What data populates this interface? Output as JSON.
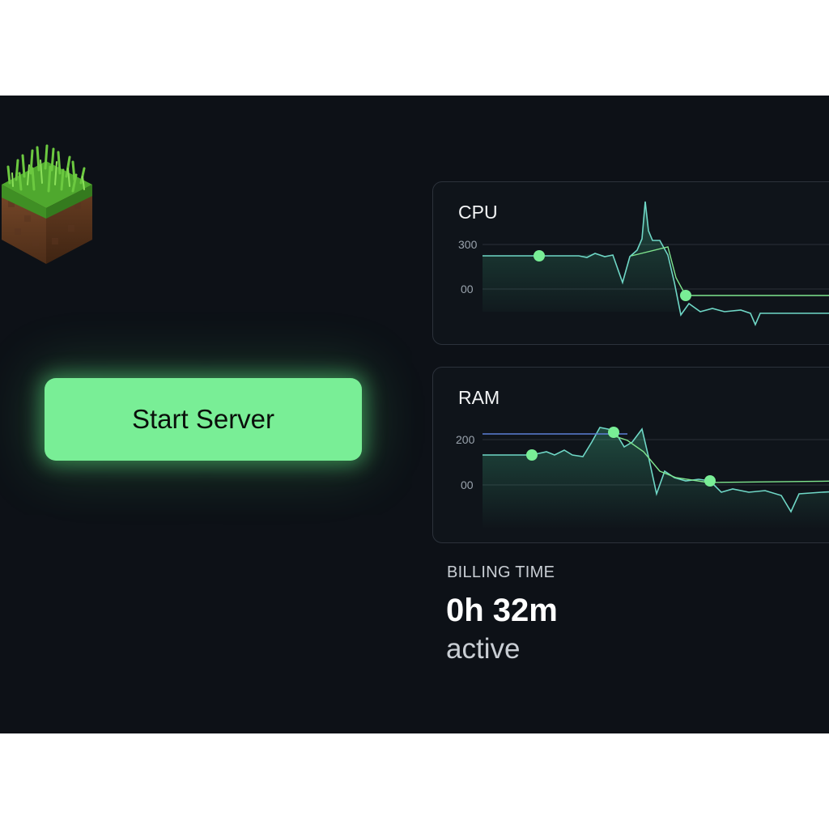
{
  "server": {
    "start_label": "Start Server"
  },
  "logo_icon": "grass-block-icon",
  "metrics": {
    "cpu": {
      "title": "CPU",
      "ticks": [
        "300",
        "00"
      ]
    },
    "ram": {
      "title": "RAM",
      "ticks": [
        "200",
        "00"
      ]
    }
  },
  "billing": {
    "label": "BILLING TIME",
    "value": "0h 32m",
    "status": "active"
  },
  "colors": {
    "accent": "#79ee96",
    "background": "#0d1117",
    "line": "#6fd7c6",
    "secondary_line": "#5b7fd6"
  }
}
